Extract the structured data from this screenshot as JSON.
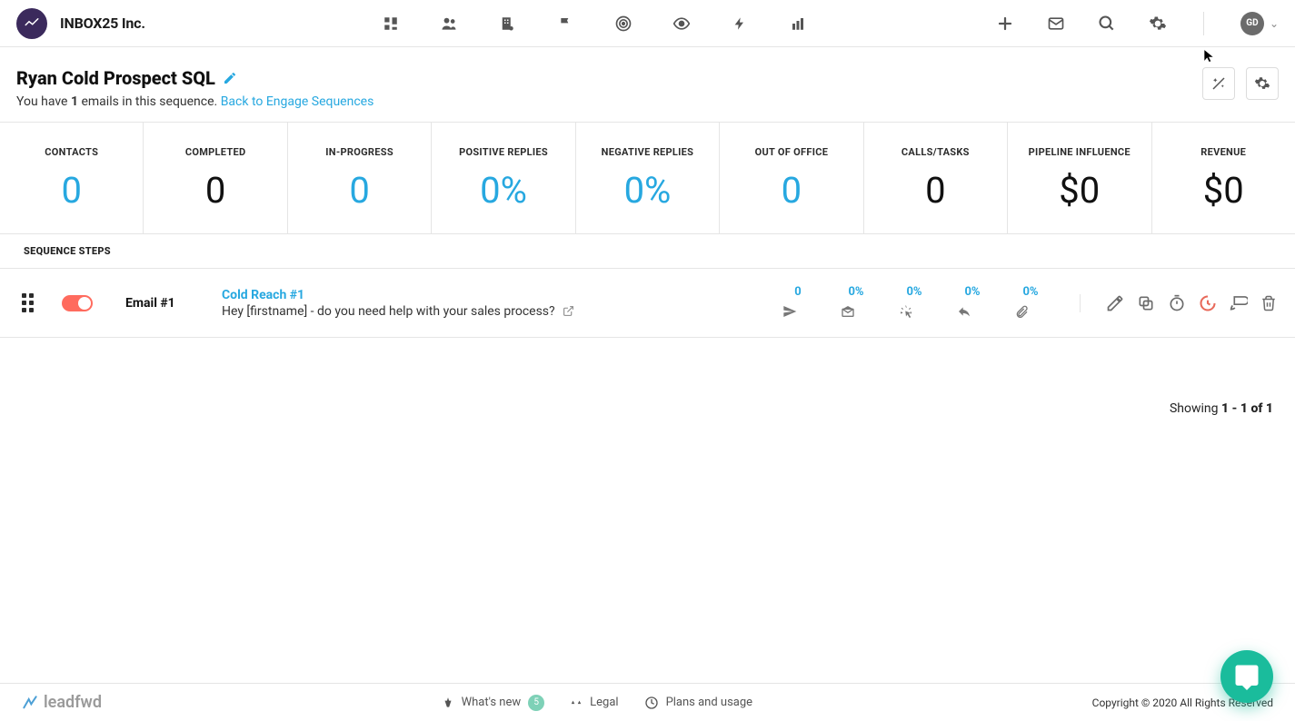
{
  "header": {
    "brand": "INBOX25 Inc.",
    "avatar_initials": "GD"
  },
  "title": {
    "name": "Ryan Cold Prospect SQL",
    "subtext_prefix": "You have ",
    "email_count": "1",
    "subtext_mid": " emails in this sequence.",
    "back_link": " Back to Engage Sequences"
  },
  "stats": [
    {
      "label": "CONTACTS",
      "value": "0",
      "accent": true
    },
    {
      "label": "COMPLETED",
      "value": "0",
      "accent": false
    },
    {
      "label": "IN-PROGRESS",
      "value": "0",
      "accent": true
    },
    {
      "label": "POSITIVE REPLIES",
      "value": "0%",
      "accent": true
    },
    {
      "label": "NEGATIVE REPLIES",
      "value": "0%",
      "accent": true
    },
    {
      "label": "OUT OF OFFICE",
      "value": "0",
      "accent": true
    },
    {
      "label": "CALLS/TASKS",
      "value": "0",
      "accent": false
    },
    {
      "label": "PIPELINE INFLUENCE",
      "value": "$0",
      "accent": false
    },
    {
      "label": "REVENUE",
      "value": "$0",
      "accent": false
    }
  ],
  "steps_header": "SEQUENCE STEPS",
  "step": {
    "label": "Email #1",
    "title": "Cold Reach #1",
    "preview": "Hey [firstname] - do you need help with your sales process?",
    "metrics": [
      {
        "value": "0",
        "icon": "send"
      },
      {
        "value": "0%",
        "icon": "open"
      },
      {
        "value": "0%",
        "icon": "click"
      },
      {
        "value": "0%",
        "icon": "reply"
      },
      {
        "value": "0%",
        "icon": "attach"
      }
    ]
  },
  "pagination": {
    "prefix": "Showing ",
    "range": "1 - 1 of 1"
  },
  "footer": {
    "brand": "leadfwd",
    "whatsnew": "What's new",
    "whatsnew_badge": "5",
    "legal": "Legal",
    "plans": "Plans and usage",
    "copyright": "Copyright © 2020 All Rights Reserved"
  }
}
